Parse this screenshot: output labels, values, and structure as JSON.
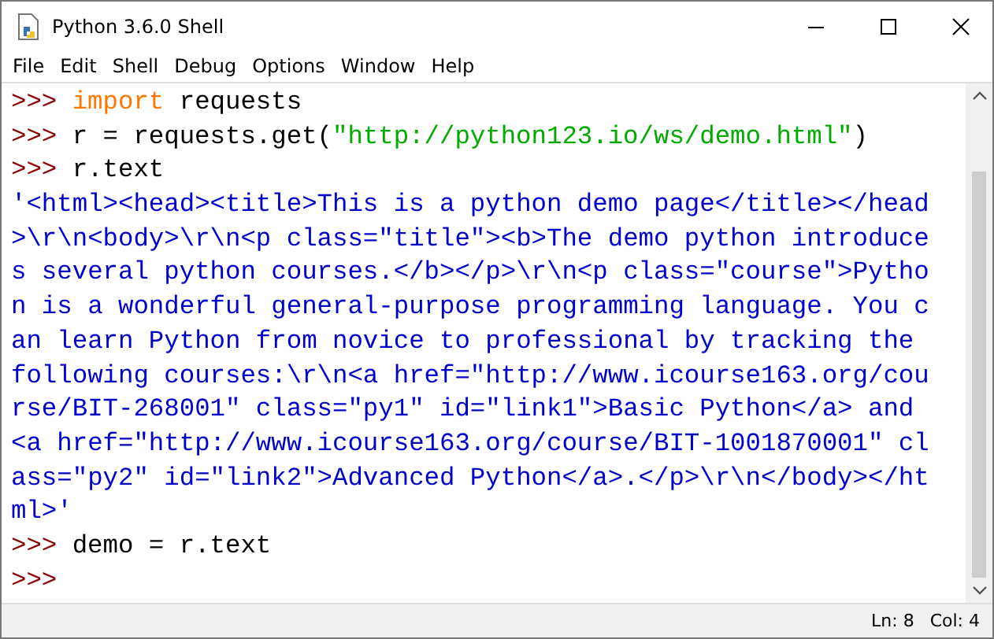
{
  "window": {
    "title": "Python 3.6.0 Shell"
  },
  "menu": [
    "File",
    "Edit",
    "Shell",
    "Debug",
    "Options",
    "Window",
    "Help"
  ],
  "lines": [
    [
      {
        "kind": "prompt",
        "text": ">>>"
      },
      {
        "kind": "keyword",
        "text": "import"
      },
      {
        "kind": "code",
        "text": " requests"
      }
    ],
    [
      {
        "kind": "prompt",
        "text": ">>>"
      },
      {
        "kind": "code",
        "text": "r = requests.get("
      },
      {
        "kind": "string",
        "text": "\"http://python123.io/ws/demo.html\""
      },
      {
        "kind": "code",
        "text": ")"
      }
    ],
    [
      {
        "kind": "prompt",
        "text": ">>>"
      },
      {
        "kind": "code",
        "text": "r.text"
      }
    ],
    [
      {
        "kind": "output",
        "text": "'<html><head><title>This is a python demo page</title></head"
      }
    ],
    [
      {
        "kind": "output",
        "text": ">\\r\\n<body>\\r\\n<p class=\"title\"><b>The demo python introduce"
      }
    ],
    [
      {
        "kind": "output",
        "text": "s several python courses.</b></p>\\r\\n<p class=\"course\">Pytho"
      }
    ],
    [
      {
        "kind": "output",
        "text": "n is a wonderful general-purpose programming language. You c"
      }
    ],
    [
      {
        "kind": "output",
        "text": "an learn Python from novice to professional by tracking the"
      }
    ],
    [
      {
        "kind": "output",
        "text": "following courses:\\r\\n<a href=\"http://www.icourse163.org/cou"
      }
    ],
    [
      {
        "kind": "output",
        "text": "rse/BIT-268001\" class=\"py1\" id=\"link1\">Basic Python</a> and"
      }
    ],
    [
      {
        "kind": "output",
        "text": "<a href=\"http://www.icourse163.org/course/BIT-1001870001\" cl"
      }
    ],
    [
      {
        "kind": "output",
        "text": "ass=\"py2\" id=\"link2\">Advanced Python</a>.</p>\\r\\n</body></ht"
      }
    ],
    [
      {
        "kind": "output",
        "text": "ml>'"
      }
    ],
    [
      {
        "kind": "prompt",
        "text": ">>>"
      },
      {
        "kind": "code",
        "text": "demo = r.text"
      }
    ],
    [
      {
        "kind": "prompt",
        "text": ">>>"
      }
    ]
  ],
  "status_bar": {
    "line": "Ln: 8",
    "column": "Col: 4"
  }
}
